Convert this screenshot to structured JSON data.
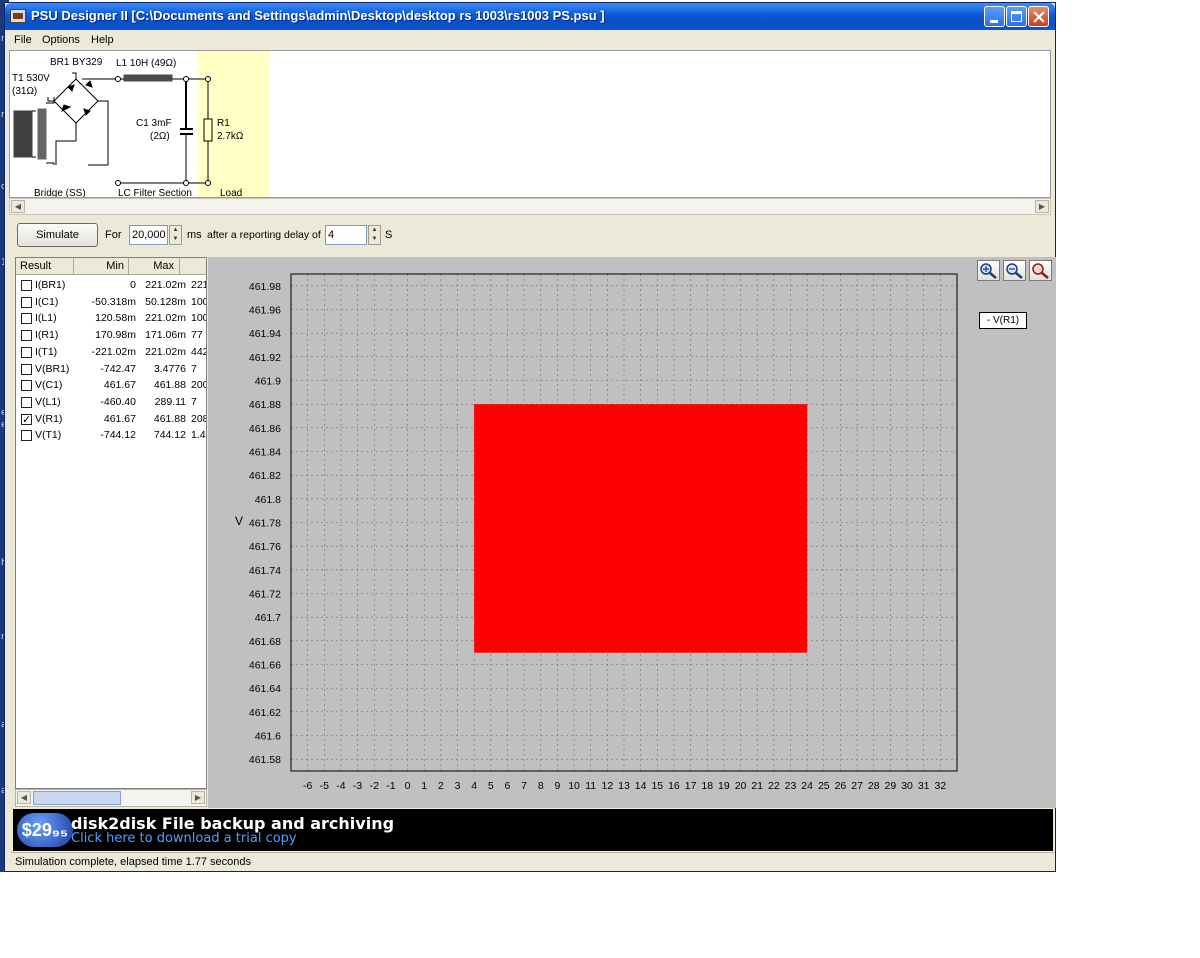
{
  "window": {
    "title": "PSU Designer II  [C:\\Documents and Settings\\admin\\Desktop\\desktop rs 1003\\rs1003 PS.psu ]"
  },
  "menu": [
    "File",
    "Options",
    "Help"
  ],
  "schematic": {
    "bridge_label": "BR1 BY329",
    "choke_label": "L1 10H (49Ω)",
    "transformer_label": "T1 530V",
    "transformer_res": "(31Ω)",
    "cap_label": "C1 3mF",
    "cap_res": "(2Ω)",
    "load_label": "R1",
    "load_value": "2.7kΩ",
    "section_bridge": "Bridge (SS)",
    "section_filter": "LC Filter Section",
    "section_load": "Load"
  },
  "controls": {
    "simulate": "Simulate",
    "for_label": "For",
    "duration": "20,000",
    "ms_label": "ms",
    "delay_label": "after a reporting delay of",
    "delay": "4",
    "s_label": "S"
  },
  "results": {
    "headers": [
      "Result",
      "Min",
      "Max"
    ],
    "rows": [
      {
        "name": "I(BR1)",
        "min": "0",
        "max": "221.02m",
        "extra": "221",
        "checked": false
      },
      {
        "name": "I(C1)",
        "min": "-50.318m",
        "max": "50.128m",
        "extra": "100",
        "checked": false
      },
      {
        "name": "I(L1)",
        "min": "120.58m",
        "max": "221.02m",
        "extra": "100",
        "checked": false
      },
      {
        "name": "I(R1)",
        "min": "170.98m",
        "max": "171.06m",
        "extra": "77",
        "checked": false
      },
      {
        "name": "I(T1)",
        "min": "-221.02m",
        "max": "221.02m",
        "extra": "442",
        "checked": false
      },
      {
        "name": "V(BR1)",
        "min": "-742.47",
        "max": "3.4776",
        "extra": "7",
        "checked": false
      },
      {
        "name": "V(C1)",
        "min": "461.67",
        "max": "461.88",
        "extra": "200",
        "checked": false
      },
      {
        "name": "V(L1)",
        "min": "-460.40",
        "max": "289.11",
        "extra": "7",
        "checked": false
      },
      {
        "name": "V(R1)",
        "min": "461.67",
        "max": "461.88",
        "extra": "208",
        "checked": true
      },
      {
        "name": "V(T1)",
        "min": "-744.12",
        "max": "744.12",
        "extra": "1.4",
        "checked": false
      }
    ]
  },
  "chart_data": {
    "type": "area",
    "ylabel": "V",
    "xlabel": "",
    "title": "",
    "ylim": [
      461.57,
      461.99
    ],
    "xlim": [
      -7,
      33
    ],
    "grid": true,
    "legend_position": "top-right",
    "y_ticks": [
      "461.98",
      "461.96",
      "461.94",
      "461.92",
      "461.9",
      "461.88",
      "461.86",
      "461.84",
      "461.82",
      "461.8",
      "461.78",
      "461.76",
      "461.74",
      "461.72",
      "461.7",
      "461.68",
      "461.66",
      "461.64",
      "461.62",
      "461.6",
      "461.58"
    ],
    "x_ticks": [
      "-6",
      "-5",
      "-4",
      "-3",
      "-2",
      "-1",
      "0",
      "1",
      "2",
      "3",
      "4",
      "5",
      "6",
      "7",
      "8",
      "9",
      "10",
      "11",
      "12",
      "13",
      "14",
      "15",
      "16",
      "17",
      "18",
      "19",
      "20",
      "21",
      "22",
      "23",
      "24",
      "25",
      "26",
      "27",
      "28",
      "29",
      "30",
      "31",
      "32"
    ],
    "series": [
      {
        "name": "V(R1)",
        "color": "#ff0000",
        "x_start": 4,
        "x_end": 24,
        "y_min": 461.67,
        "y_max": 461.88
      }
    ]
  },
  "legend_label": "- V(R1)",
  "zoom_icons": [
    "zoom-in-icon",
    "zoom-out-icon",
    "zoom-reset-icon"
  ],
  "banner": {
    "price": "$29₉₅",
    "headline": "disk2disk File backup and archiving",
    "sub": "Click here to download a trial copy"
  },
  "status": "Simulation complete, elapsed time 1.77 seconds",
  "desktop_strip": [
    "r",
    "r",
    "o",
    "1",
    "e",
    "e",
    "h",
    "n",
    "a",
    "a"
  ]
}
